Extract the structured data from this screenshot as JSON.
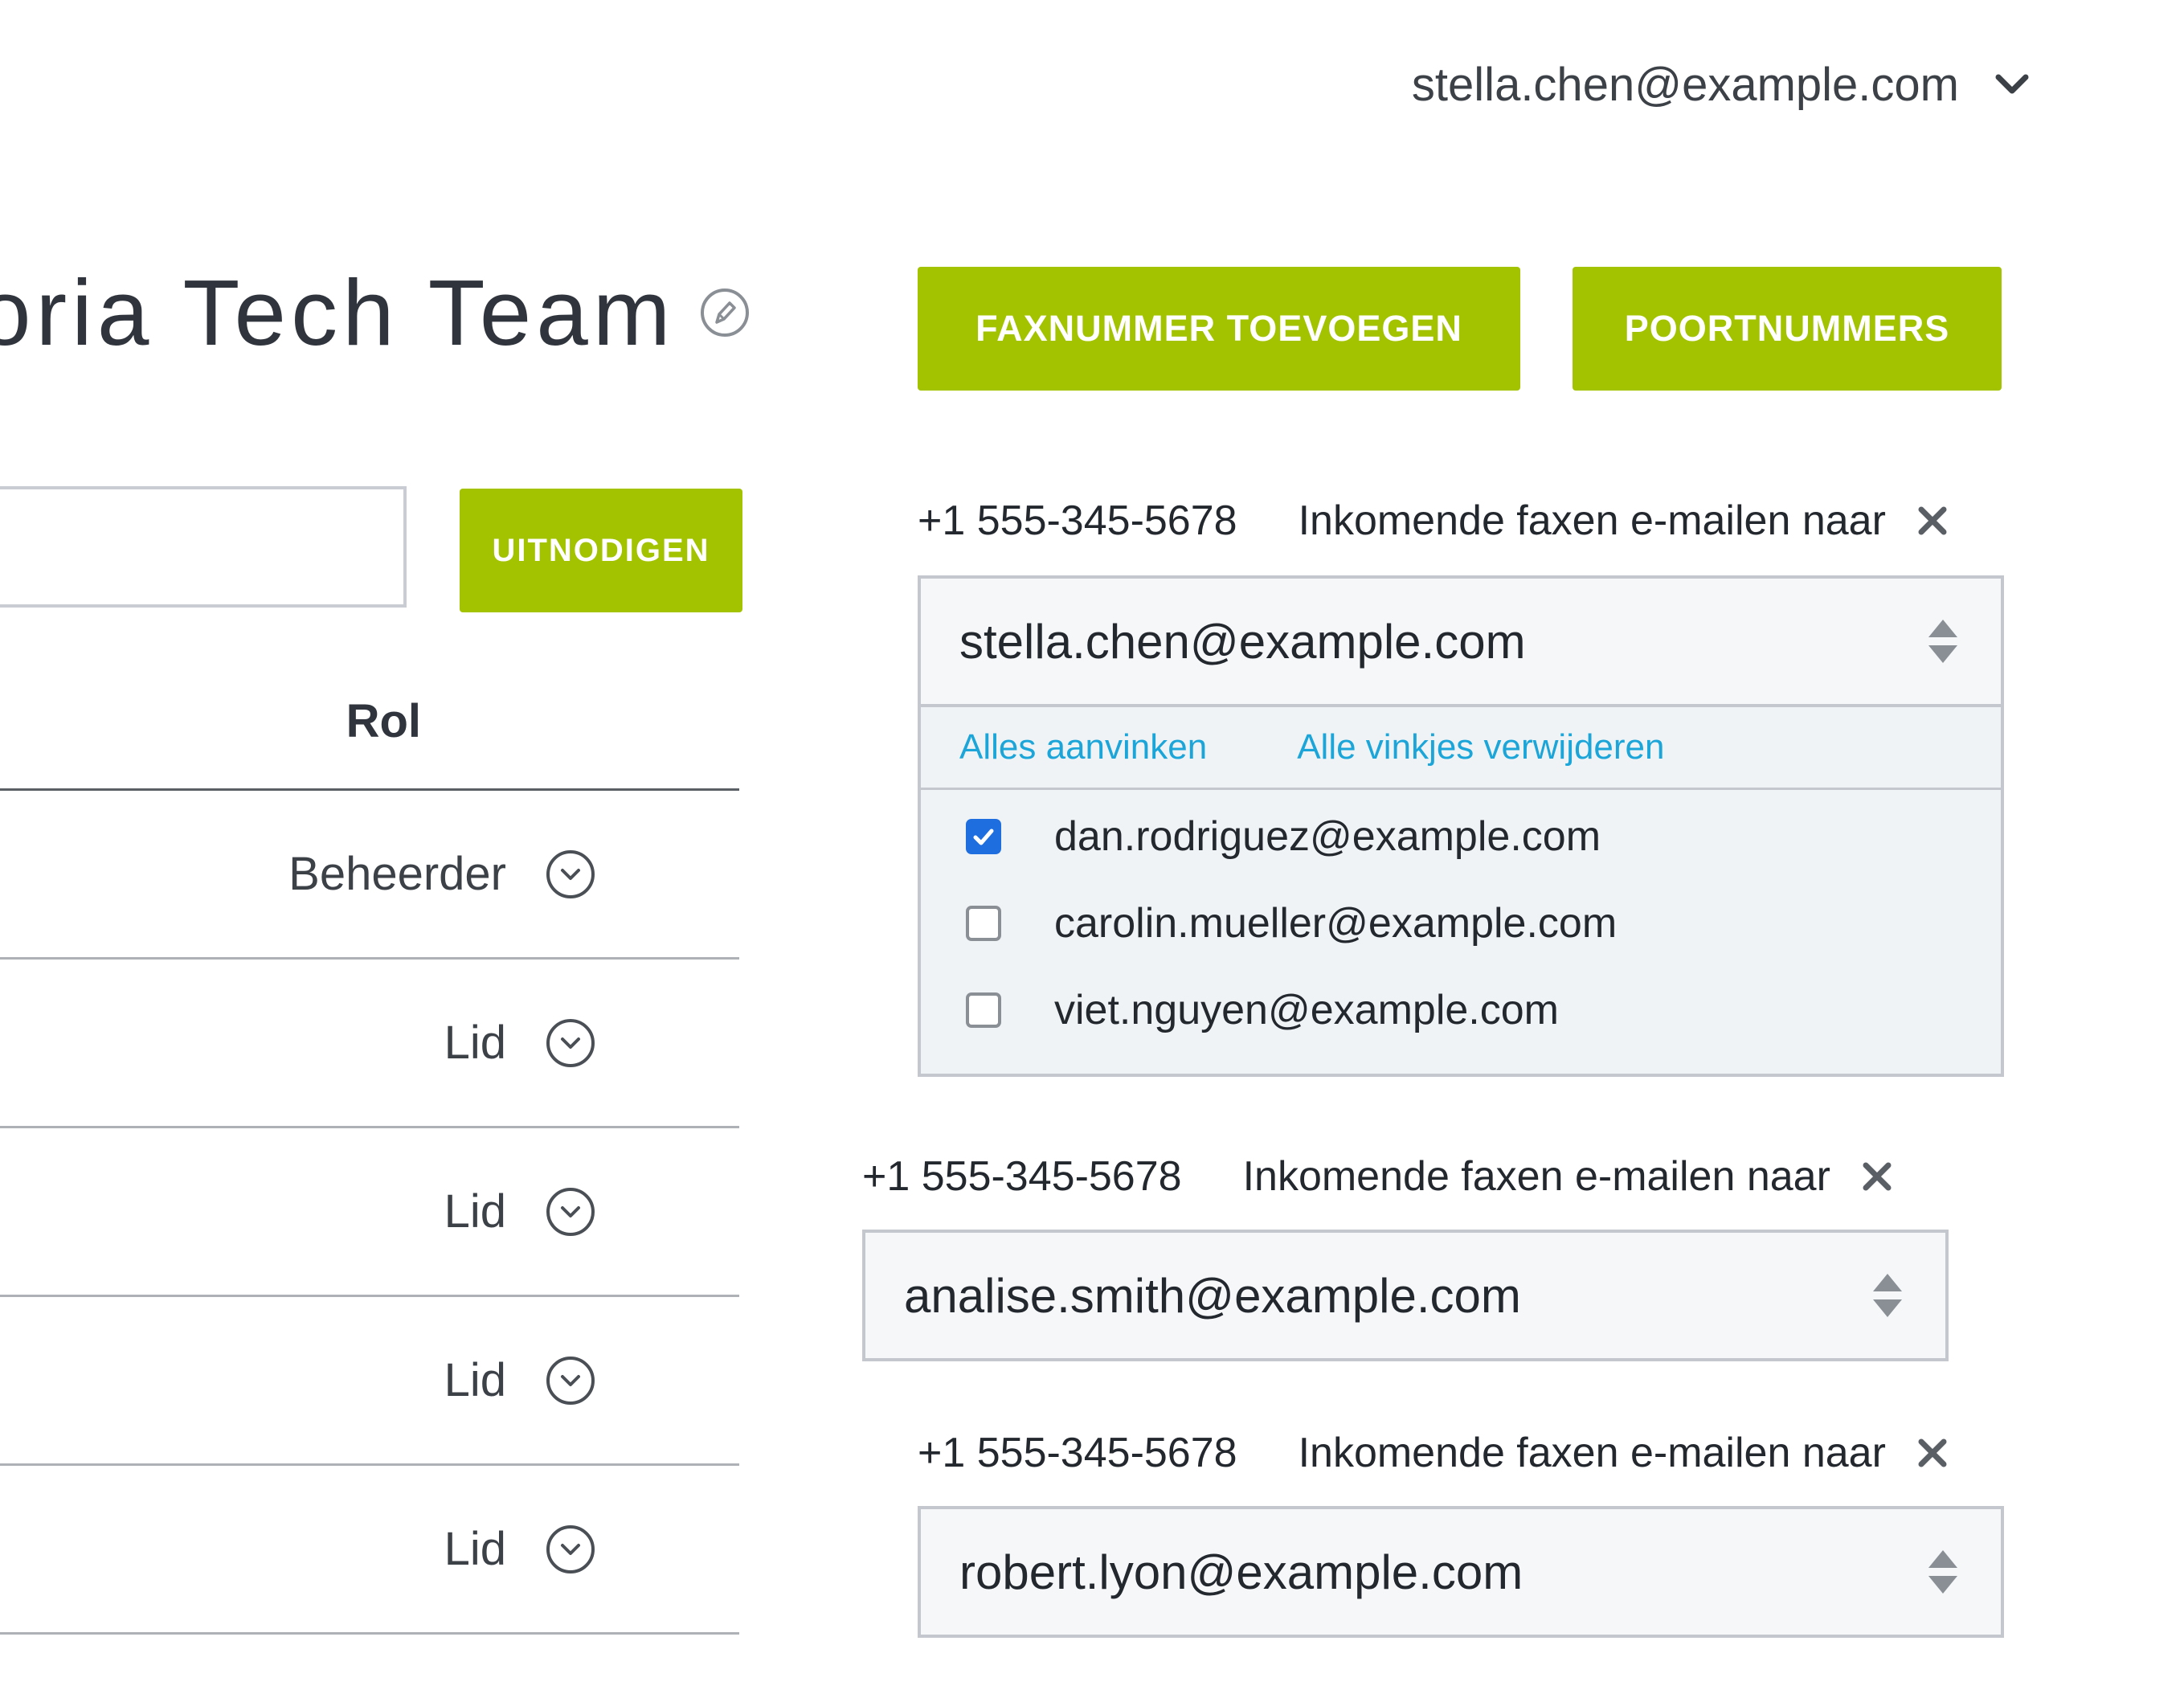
{
  "header": {
    "user_email": "stella.chen@example.com"
  },
  "team": {
    "title": "oria Tech Team"
  },
  "invite": {
    "input_value": "",
    "button_label": "UITNODIGEN"
  },
  "roles": {
    "header": "Rol",
    "rows": [
      {
        "label": "Beheerder"
      },
      {
        "label": "Lid"
      },
      {
        "label": "Lid"
      },
      {
        "label": "Lid"
      },
      {
        "label": "Lid"
      }
    ]
  },
  "toolbar": {
    "add_fax_label": "FAXNUMMER TOEVOEGEN",
    "port_numbers_label": "POORTNUMMERS"
  },
  "fax_entries": [
    {
      "number": "+1 555-345-5678",
      "label": "Inkomende faxen e-mailen naar",
      "selected": "stella.chen@example.com"
    },
    {
      "number": "+1 555-345-5678",
      "label": "Inkomende faxen e-mailen naar",
      "selected": "analise.smith@example.com"
    },
    {
      "number": "+1 555-345-5678",
      "label": "Inkomende faxen e-mailen naar",
      "selected": "robert.lyon@example.com"
    }
  ],
  "dropdown": {
    "select_all": "Alles aanvinken",
    "clear_all": "Alle vinkjes verwijderen",
    "options": [
      {
        "email": "dan.rodriguez@example.com",
        "checked": true
      },
      {
        "email": "carolin.mueller@example.com",
        "checked": false
      },
      {
        "email": "viet.nguyen@example.com",
        "checked": false
      }
    ]
  },
  "colors": {
    "accent": "#a3c200",
    "link": "#1ba5d8",
    "checkbox": "#1e6ee0",
    "text": "#30353d"
  },
  "icons": {
    "user_menu": "chevron-down-icon",
    "edit": "pencil-icon",
    "role_toggle": "chevron-down-circle-icon",
    "remove": "close-icon",
    "select": "sort-arrows-icon",
    "check": "checkmark-icon"
  }
}
